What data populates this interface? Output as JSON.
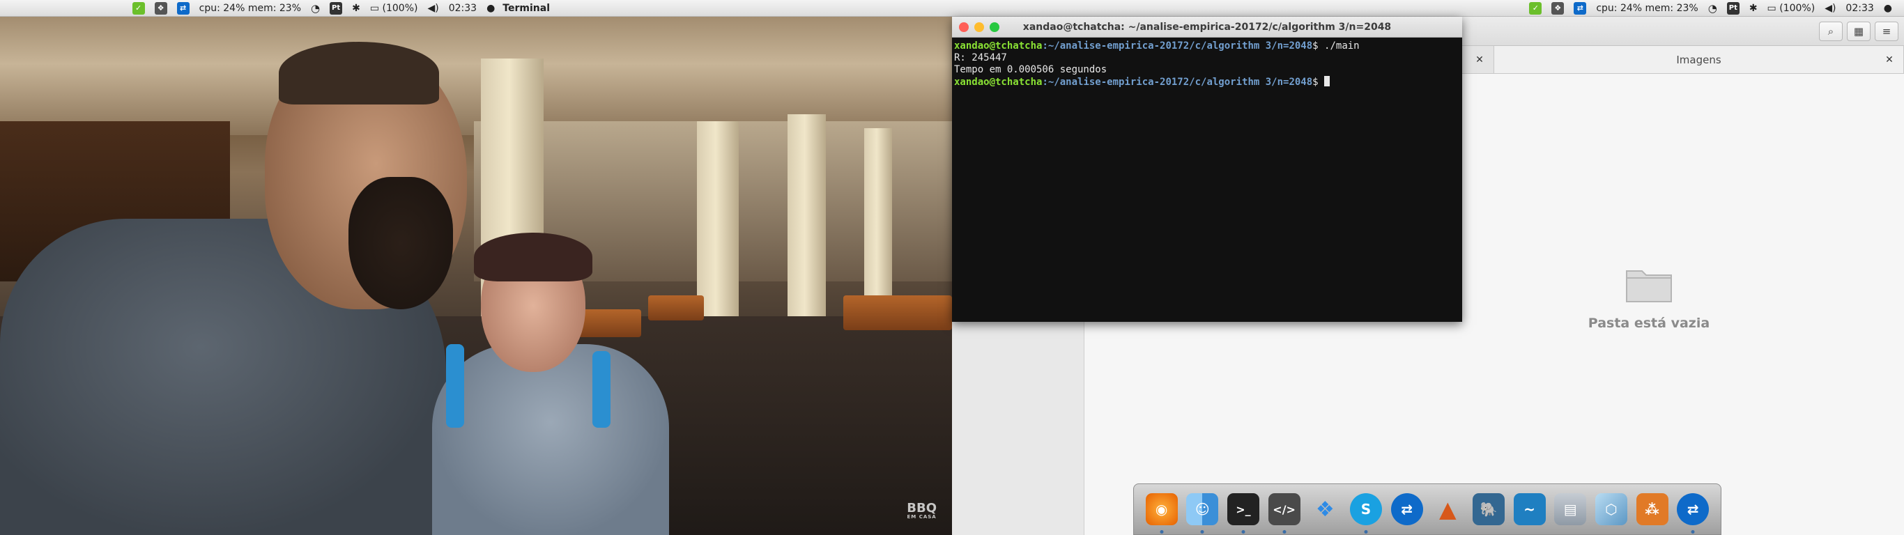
{
  "panel": {
    "cpu_mem": "cpu: 24% mem: 23%",
    "keyboard": "Pt",
    "battery": "(100%)",
    "time": "02:33",
    "app_name": "Terminal"
  },
  "video": {
    "watermark_big": "BBQ",
    "watermark_small": "EM CASA"
  },
  "terminal": {
    "title": "xandao@tchatcha: ~/analise-empirica-20172/c/algorithm 3/n=2048",
    "prompt_user": "xandao@tchatcha",
    "prompt_path": ":~/analise-empirica-20172/c/algorithm 3/n=2048",
    "prompt_symbol": "$",
    "command": " ./main",
    "output_1": "R: 245447",
    "output_2": "Tempo em 0.000506 segundos"
  },
  "file_manager": {
    "tab_label": "Imagens",
    "empty_message": "Pasta está vazia"
  },
  "dock": {
    "items": [
      {
        "name": "firefox",
        "color": "#e66000",
        "running": true
      },
      {
        "name": "finder",
        "color": "#3b8fd8",
        "running": true
      },
      {
        "name": "terminal",
        "color": "#222222",
        "running": true
      },
      {
        "name": "code-editor",
        "color": "#4a4a4a",
        "running": true
      },
      {
        "name": "dropbox",
        "color": "#2e8be6",
        "running": false
      },
      {
        "name": "skype",
        "color": "#1aa1e1",
        "running": true
      },
      {
        "name": "teamviewer",
        "color": "#0e6ac9",
        "running": false
      },
      {
        "name": "matlab",
        "color": "#d7581a",
        "running": false
      },
      {
        "name": "postgresql",
        "color": "#336791",
        "running": false
      },
      {
        "name": "mysql-workbench",
        "color": "#1f7fc1",
        "running": false
      },
      {
        "name": "image-viewer",
        "color": "#8f9aa6",
        "running": false
      },
      {
        "name": "virtualbox",
        "color": "#7fb3d5",
        "running": false
      },
      {
        "name": "network-app",
        "color": "#e17a27",
        "running": false
      },
      {
        "name": "teamviewer-2",
        "color": "#0e6ac9",
        "running": true
      }
    ]
  },
  "colors": {
    "close": "#ff5f57",
    "minimize": "#febc2e",
    "maximize": "#28c840",
    "terminal_user": "#8ae234",
    "terminal_path": "#729fcf"
  }
}
